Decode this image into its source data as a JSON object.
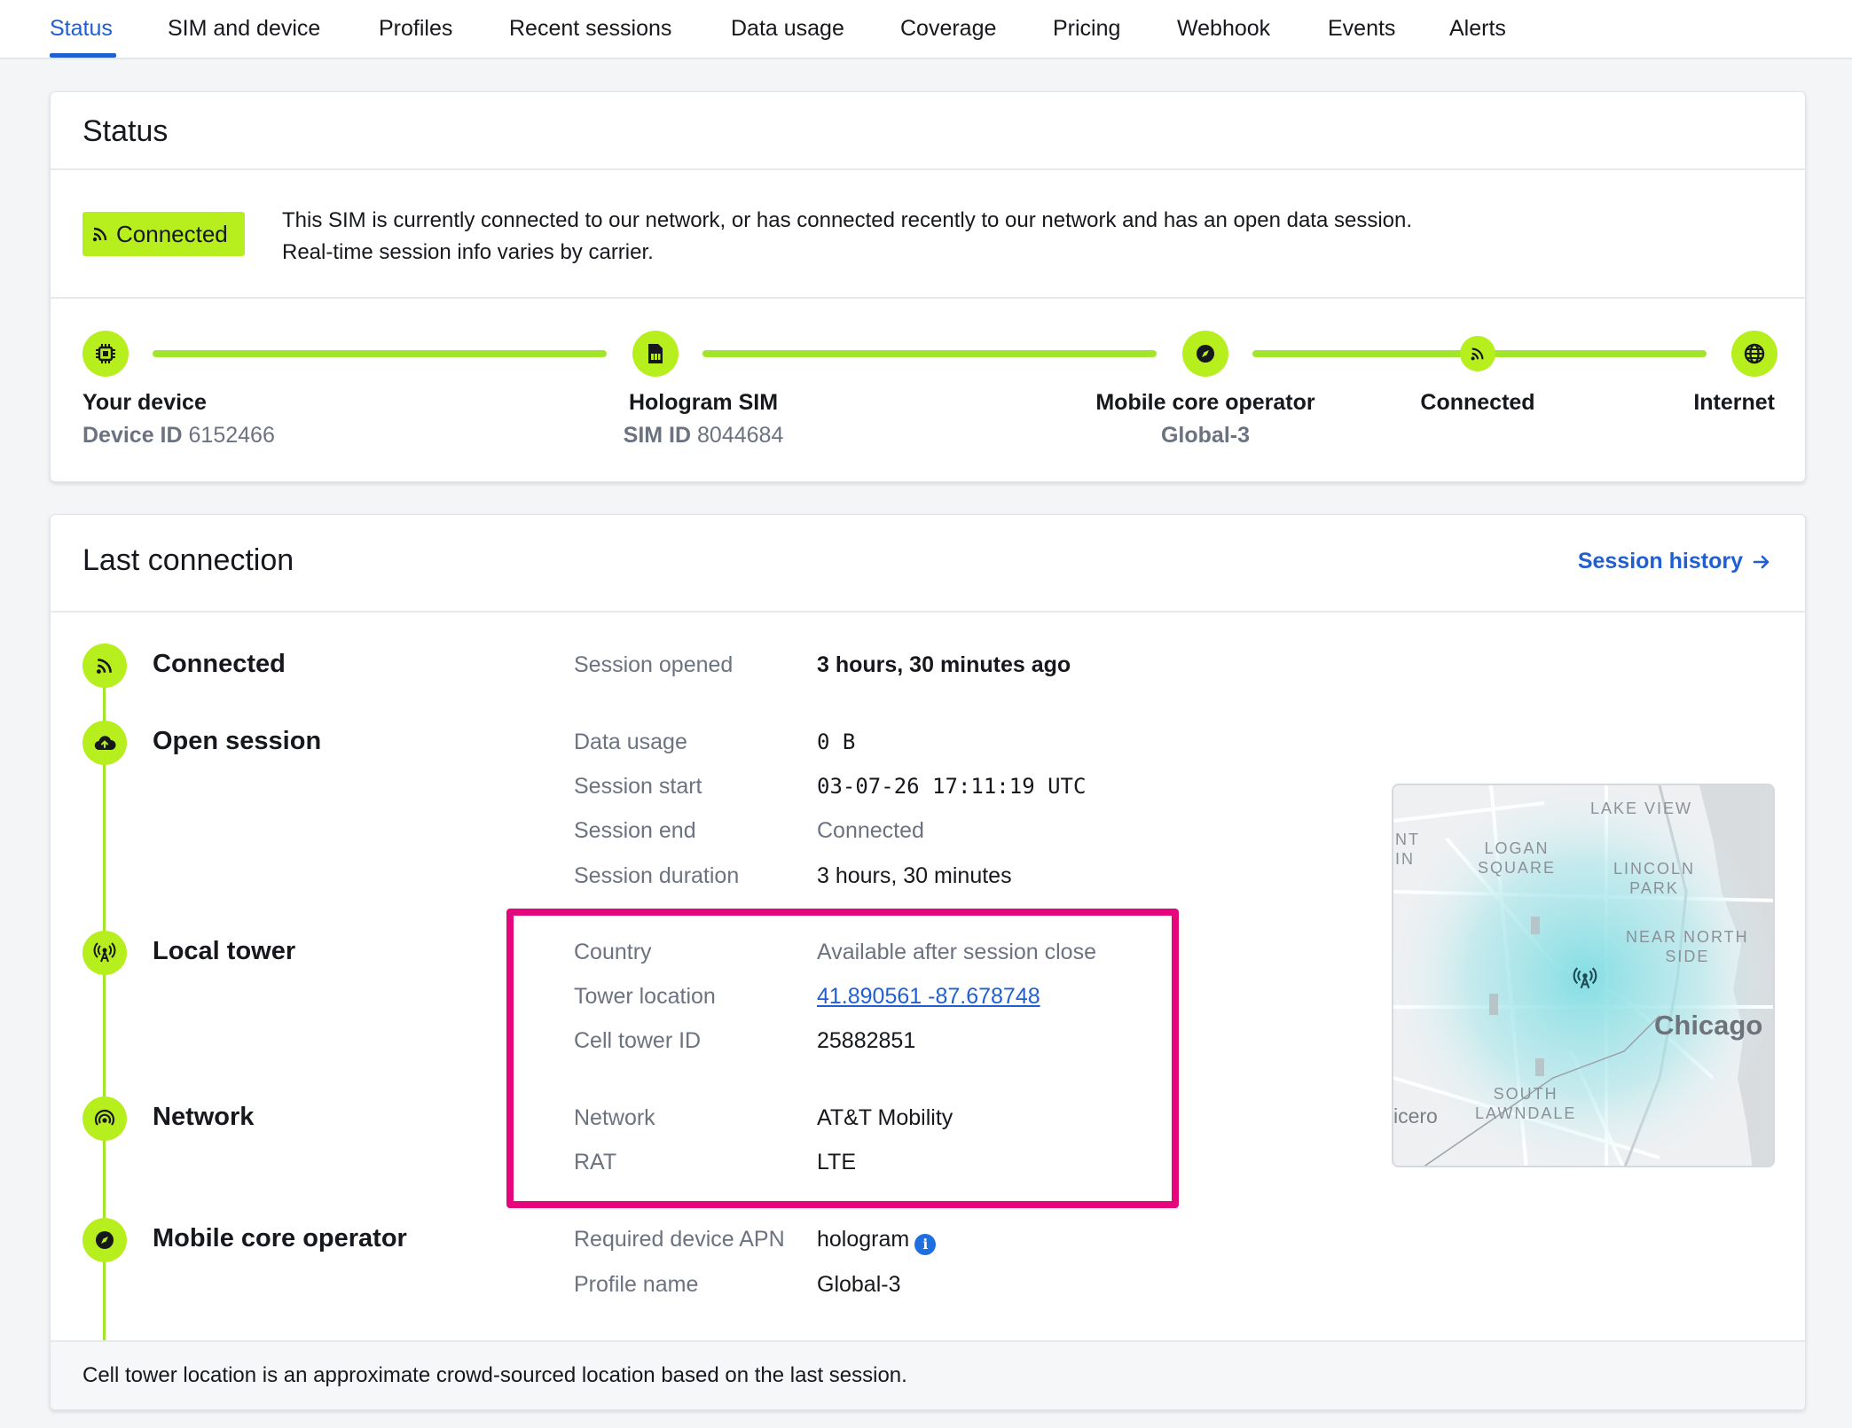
{
  "tabs": [
    {
      "label": "Status",
      "active": true
    },
    {
      "label": "SIM and device"
    },
    {
      "label": "Profiles"
    },
    {
      "label": "Recent sessions"
    },
    {
      "label": "Data usage"
    },
    {
      "label": "Coverage"
    },
    {
      "label": "Pricing"
    },
    {
      "label": "Webhook"
    },
    {
      "label": "Events"
    },
    {
      "label": "Alerts"
    }
  ],
  "status_card": {
    "title": "Status",
    "badge": "Connected",
    "description_line1": "This SIM is currently connected to our network, or has connected recently to our network and has an open data session.",
    "description_line2": "Real-time session info varies by carrier.",
    "steps": {
      "device": {
        "label": "Your device",
        "sub_key": "Device ID",
        "sub_val": "6152466",
        "icon": "chip-icon"
      },
      "sim": {
        "label": "Hologram SIM",
        "sub_key": "SIM ID",
        "sub_val": "8044684",
        "icon": "sim-icon"
      },
      "operator": {
        "label": "Mobile core operator",
        "sub": "Global-3",
        "icon": "compass-icon"
      },
      "connected": {
        "label": "Connected",
        "icon": "signal-icon"
      },
      "internet": {
        "label": "Internet",
        "icon": "globe-icon"
      }
    }
  },
  "last_connection": {
    "title": "Last connection",
    "history_link": "Session history",
    "stages": {
      "connected": {
        "label": "Connected",
        "rows": [
          {
            "key": "Session opened",
            "value": "3 hours, 30 minutes ago"
          }
        ]
      },
      "open_session": {
        "label": "Open session",
        "rows": [
          {
            "key": "Data usage",
            "value": "0 B"
          },
          {
            "key": "Session start",
            "value": "03-07-26 17:11:19 UTC"
          },
          {
            "key": "Session end",
            "value": "Connected"
          },
          {
            "key": "Session duration",
            "value": "3 hours, 30 minutes"
          }
        ]
      },
      "local_tower": {
        "label": "Local tower",
        "rows": [
          {
            "key": "Country",
            "value": "Available after session close"
          },
          {
            "key": "Tower location",
            "value": "41.890561 -87.678748"
          },
          {
            "key": "Cell tower ID",
            "value": "25882851"
          }
        ]
      },
      "network": {
        "label": "Network",
        "rows": [
          {
            "key": "Network",
            "value": "AT&T Mobility"
          },
          {
            "key": "RAT",
            "value": "LTE"
          }
        ]
      },
      "mobile_core": {
        "label": "Mobile core operator",
        "rows": [
          {
            "key": "Required device APN",
            "value": "hologram"
          },
          {
            "key": "Profile name",
            "value": "Global-3"
          }
        ]
      }
    },
    "map": {
      "labels": {
        "lake_view": "LAKE VIEW",
        "logan_square": "LOGAN\nSQUARE",
        "lincoln_park": "LINCOLN\nPARK",
        "near_north": "NEAR NORTH\nSIDE",
        "chicago": "Chicago",
        "south_lawndale": "SOUTH\nLAWNDALE",
        "cicero": "icero",
        "edge": "NT\nIN"
      }
    },
    "footer": "Cell tower location is an approximate crowd-sourced location based on the last session."
  },
  "colors": {
    "accent": "#1f5fd1",
    "status_green": "#b6ee1e",
    "highlight": "#e5067d"
  }
}
